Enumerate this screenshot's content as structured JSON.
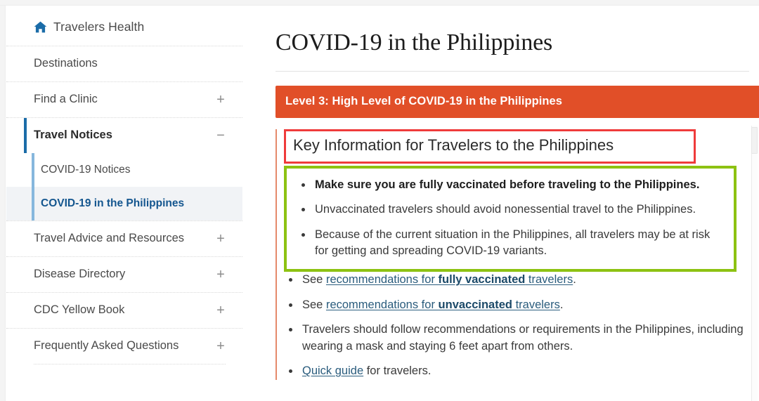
{
  "sidebar": {
    "home": {
      "label": "Travelers Health",
      "icon": "home-icon"
    },
    "items": [
      {
        "label": "Destinations",
        "toggle": ""
      },
      {
        "label": "Find a Clinic",
        "toggle": "+"
      },
      {
        "label": "Travel Notices",
        "toggle": "−"
      },
      {
        "label": "Travel Advice and Resources",
        "toggle": "+"
      },
      {
        "label": "Disease Directory",
        "toggle": "+"
      },
      {
        "label": "CDC Yellow Book",
        "toggle": "+"
      },
      {
        "label": "Frequently Asked Questions",
        "toggle": "+"
      }
    ],
    "subitems": [
      {
        "label": "COVID-19 Notices"
      },
      {
        "label": "COVID-19 in the Philippines"
      }
    ]
  },
  "main": {
    "title": "COVID-19 in the Philippines",
    "alert_banner": "Level 3: High Level of COVID-19 in the Philippines",
    "key_info_heading": "Key Information for Travelers to the Philippines",
    "key_box_bullets": [
      "Make sure you are fully vaccinated before traveling to the Philippines.",
      "Unvaccinated travelers should avoid nonessential travel to the Philippines.",
      "Because of the current situation in the Philippines, all travelers may be at risk for getting and spreading COVID-19 variants."
    ],
    "outer_bullets": [
      {
        "parts": [
          {
            "type": "text",
            "text": "See "
          },
          {
            "type": "link",
            "text": "recommendations for "
          },
          {
            "type": "link-bold",
            "text": "fully vaccinated"
          },
          {
            "type": "link",
            "text": " travelers"
          },
          {
            "type": "text",
            "text": "."
          }
        ]
      },
      {
        "parts": [
          {
            "type": "text",
            "text": "See "
          },
          {
            "type": "link",
            "text": "recommendations for "
          },
          {
            "type": "link-bold",
            "text": "unvaccinated"
          },
          {
            "type": "link",
            "text": " travelers"
          },
          {
            "type": "text",
            "text": "."
          }
        ]
      },
      {
        "parts": [
          {
            "type": "text",
            "text": "Travelers should follow recommendations or requirements in the Philippines, including wearing a mask and staying 6 feet apart from others."
          }
        ]
      },
      {
        "parts": [
          {
            "type": "link",
            "text": "Quick guide"
          },
          {
            "type": "text",
            "text": " for travelers."
          }
        ]
      }
    ]
  },
  "colors": {
    "alert_orange": "#e14f28",
    "highlight_red": "#ef3b3b",
    "highlight_green": "#8dc212",
    "link_blue": "#2a5c7d",
    "active_nav_blue": "#14568f",
    "accent_rail": "#1b6ca8"
  }
}
